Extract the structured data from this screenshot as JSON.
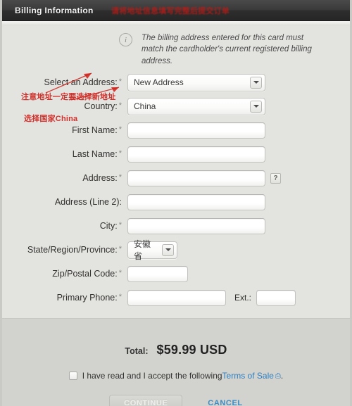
{
  "window": {
    "title": "Billing Information",
    "header_annotation": "请将地址信息填写完整后提交订单"
  },
  "notice": {
    "icon": "info-icon",
    "text": "The billing address entered for this card must match the cardholder's current registered billing address."
  },
  "annotations": [
    {
      "id": "address",
      "text": "注意地址一定要选择新地址"
    },
    {
      "id": "country",
      "text": "选择国家China"
    }
  ],
  "form": {
    "required_marker": "*",
    "fields": [
      {
        "label": "Select an Address:",
        "required": true,
        "type": "select",
        "value": "New Address"
      },
      {
        "label": "Country:",
        "required": true,
        "type": "select",
        "value": "China"
      },
      {
        "label": "First Name:",
        "required": true,
        "type": "text",
        "value": "",
        "placeholder": ""
      },
      {
        "label": "Last Name:",
        "required": true,
        "type": "text",
        "value": "",
        "placeholder": ""
      },
      {
        "label": "Address:",
        "required": true,
        "type": "text",
        "value": "",
        "placeholder": "",
        "help": "?"
      },
      {
        "label": "Address (Line 2):",
        "required": false,
        "type": "text",
        "value": "",
        "placeholder": ""
      },
      {
        "label": "City:",
        "required": true,
        "type": "text",
        "value": "",
        "placeholder": ""
      },
      {
        "label": "State/Region/Province:",
        "required": true,
        "type": "select",
        "value": "安徽省"
      },
      {
        "label": "Zip/Postal Code:",
        "required": true,
        "type": "text",
        "value": "",
        "placeholder": ""
      },
      {
        "label": "Primary Phone:",
        "required": true,
        "type": "text",
        "value": "",
        "placeholder": "",
        "ext_label": "Ext.:",
        "ext_value": ""
      }
    ]
  },
  "footer": {
    "total_label": "Total:",
    "total_value": "$59.99 USD",
    "terms_prefix": "I have read and I accept the following ",
    "terms_link": "Terms of Sale",
    "terms_link_icon": "external-link-icon",
    "terms_suffix": ".",
    "terms_checked": false,
    "continue_label": "CONTINUE",
    "cancel_label": "CANCEL"
  },
  "colors": {
    "titlebar": "#333333",
    "annotation_red": "#cf1f18",
    "link_blue": "#2f7fbf",
    "panel_bg": "#e3e3e0",
    "footer_bg": "#d2d2ce"
  }
}
